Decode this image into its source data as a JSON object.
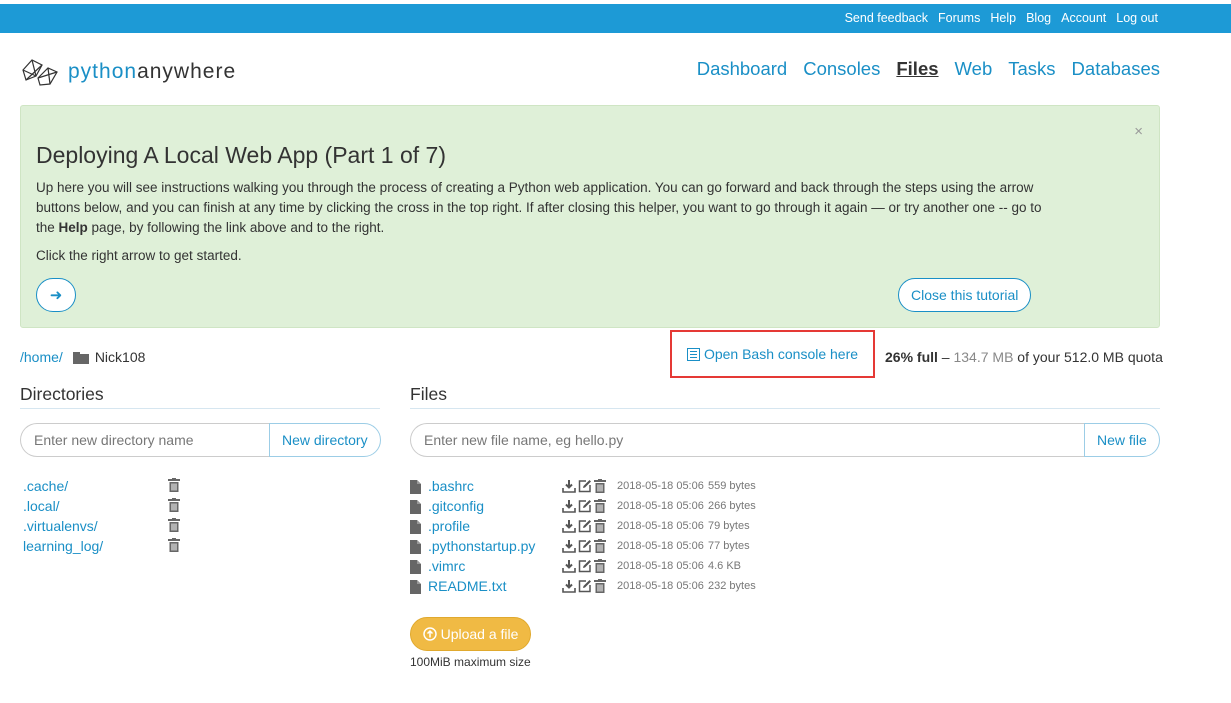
{
  "topbar": {
    "links": [
      "Send feedback",
      "Forums",
      "Help",
      "Blog",
      "Account",
      "Log out"
    ]
  },
  "logo": {
    "part1": "python",
    "part2": "anywhere"
  },
  "nav": {
    "items": [
      "Dashboard",
      "Consoles",
      "Files",
      "Web",
      "Tasks",
      "Databases"
    ],
    "active": "Files"
  },
  "tutorial": {
    "title": "Deploying A Local Web App (Part 1 of 7)",
    "desc_before": "Up here you will see instructions walking you through the process of creating a Python web application. You can go forward and back through the steps using the arrow buttons below, and you can finish at any time by clicking the cross in the top right. If after closing this helper, you want to go through it again — or try another one -- go to the ",
    "desc_bold": "Help",
    "desc_after": " page, by following the link above and to the right.",
    "hint": "Click the right arrow to get started.",
    "close_label": "Close this tutorial",
    "close_x": "×",
    "arrow": "➜"
  },
  "path": {
    "home": "/home/",
    "user": "Nick108"
  },
  "bash_label": "Open Bash console here",
  "quota": {
    "pct": "26% full",
    "dash": " – ",
    "used": "134.7 MB",
    "rest": " of your 512.0 MB quota"
  },
  "directories": {
    "title": "Directories",
    "placeholder": "Enter new directory name",
    "button": "New directory",
    "items": [
      ".cache/",
      ".local/",
      ".virtualenvs/",
      "learning_log/"
    ]
  },
  "files": {
    "title": "Files",
    "placeholder": "Enter new file name, eg hello.py",
    "button": "New file",
    "items": [
      {
        "name": ".bashrc",
        "date": "2018-05-18 05:06",
        "size": "559 bytes"
      },
      {
        "name": ".gitconfig",
        "date": "2018-05-18 05:06",
        "size": "266 bytes"
      },
      {
        "name": ".profile",
        "date": "2018-05-18 05:06",
        "size": "79 bytes"
      },
      {
        "name": ".pythonstartup.py",
        "date": "2018-05-18 05:06",
        "size": "77 bytes"
      },
      {
        "name": ".vimrc",
        "date": "2018-05-18 05:06",
        "size": "4.6 KB"
      },
      {
        "name": "README.txt",
        "date": "2018-05-18 05:06",
        "size": "232 bytes"
      }
    ]
  },
  "upload": {
    "label": "Upload a file",
    "note": "100MiB maximum size"
  },
  "colors": {
    "topbar": "#1d9ad6",
    "link": "#1a8fc6",
    "tutorial_bg": "#dff0d8",
    "upload": "#f0ba44",
    "highlight": "#e53935"
  }
}
